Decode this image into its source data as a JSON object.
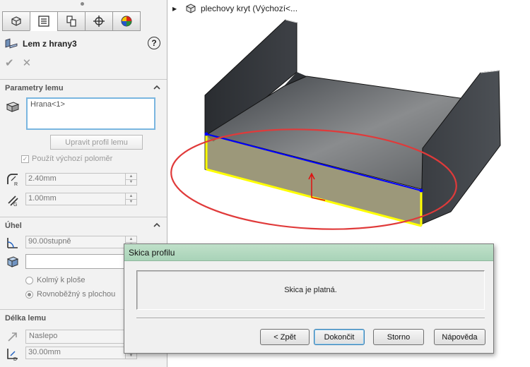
{
  "property_manager": {
    "tabs": [
      {
        "icon": "feature-manager-icon"
      },
      {
        "icon": "property-manager-icon"
      },
      {
        "icon": "configuration-manager-icon"
      },
      {
        "icon": "dimxpert-icon"
      },
      {
        "icon": "display-manager-icon"
      }
    ],
    "title": "Lem z hrany3",
    "help": "?",
    "ok_symbol": "✔",
    "cancel_symbol": "✕",
    "sections": {
      "flange_params": {
        "title": "Parametry lemu",
        "edge_list_value": "Hrana<1>",
        "edit_profile_button": "Upravit profil lemu",
        "use_default_radius_label": "Použít výchozí poloměr",
        "use_default_radius_checked": true,
        "radius_value": "2.40mm",
        "gap_value": "1.00mm"
      },
      "angle": {
        "title": "Úhel",
        "angle_value": "90.00stupně",
        "face_input_value": "",
        "option_perpendicular": "Kolmý k ploše",
        "option_parallel": "Rovnoběžný s plochou",
        "selected_option": "parallel"
      },
      "flange_length": {
        "title": "Délka lemu",
        "end_condition": "Naslepo",
        "length_value": "30.00mm"
      }
    }
  },
  "graphics": {
    "tree_item": "plechovy kryt  (Výchozí<..."
  },
  "dialog": {
    "title": "Skica profilu",
    "message": "Skica je platná.",
    "buttons": {
      "back": "< Zpět",
      "finish": "Dokončit",
      "cancel": "Storno",
      "help": "Nápověda"
    }
  },
  "colors": {
    "dialog_title_bg": "#b3d9c0",
    "selection_edge": "#ffff00",
    "sketch_line": "#0000ff",
    "highlight_ellipse": "#e03a3a",
    "accent_blue": "#7ab6e0"
  }
}
